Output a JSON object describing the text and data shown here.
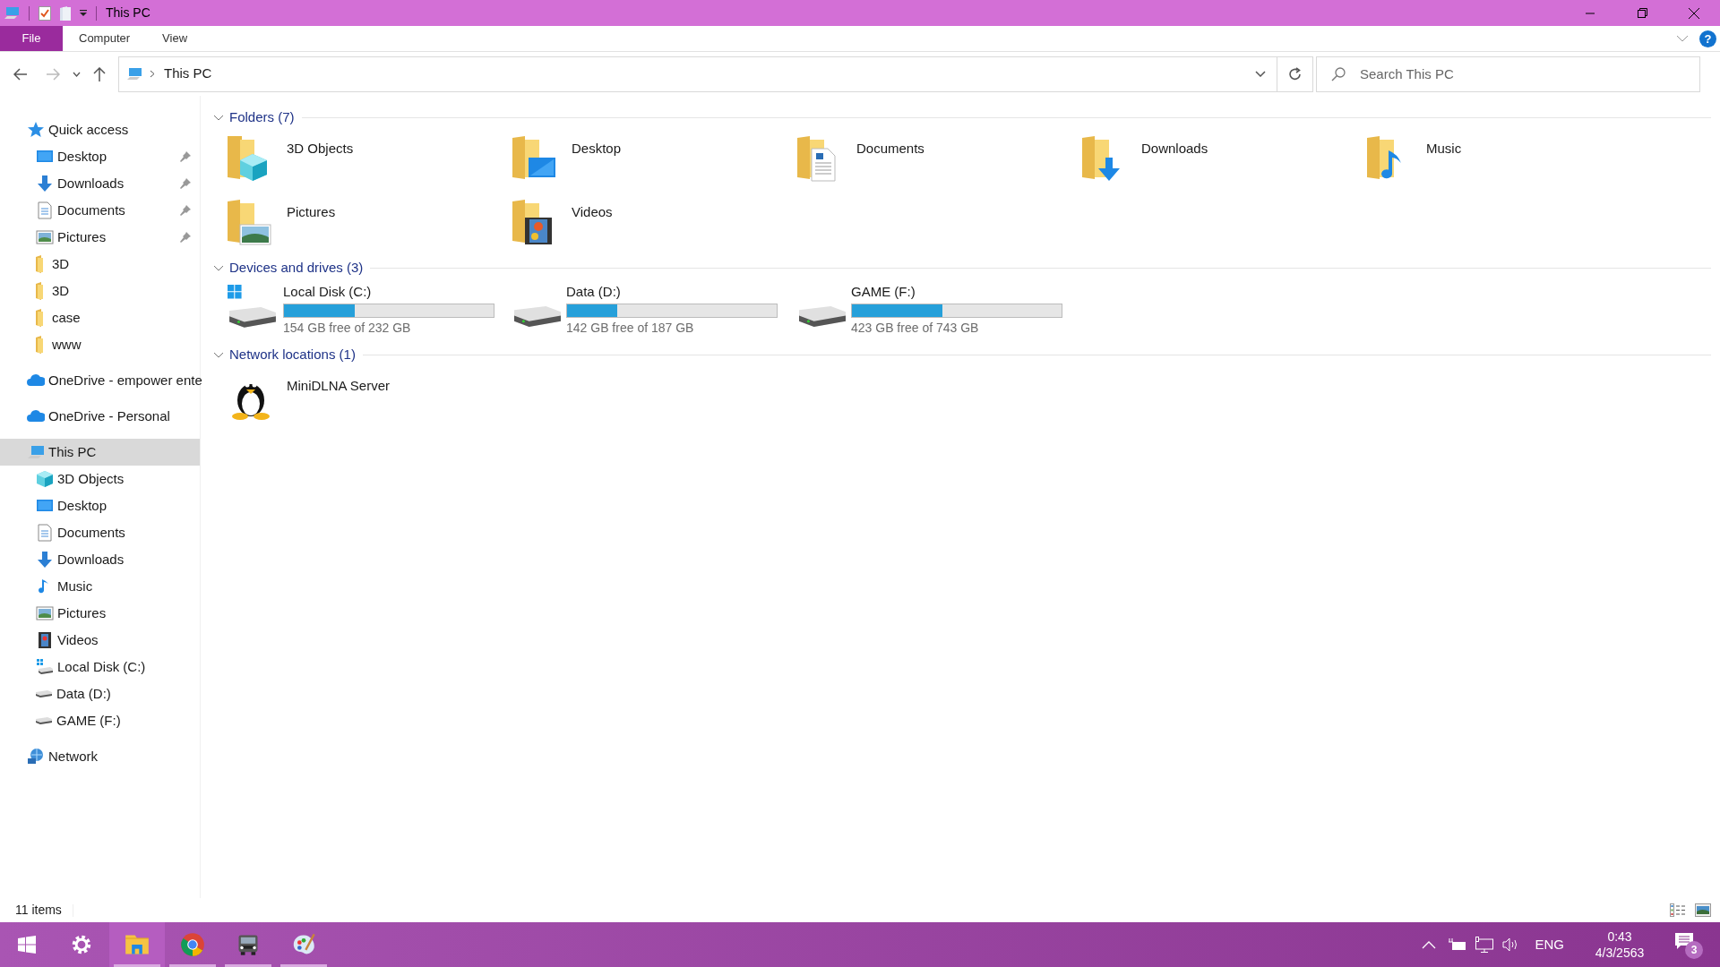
{
  "title_bar": {
    "title": "This PC"
  },
  "ribbon": {
    "help": "?",
    "tabs": [
      {
        "label": "File",
        "kind": "file"
      },
      {
        "label": "Computer",
        "kind": "tab"
      },
      {
        "label": "View",
        "kind": "tab"
      }
    ]
  },
  "address_bar": {
    "path": "This PC",
    "search_placeholder": "Search This PC"
  },
  "sidebar": {
    "items": [
      {
        "label": "Quick access",
        "kind": "star",
        "selected": false,
        "children": [
          {
            "label": "Desktop",
            "kind": "desktop",
            "pinned": true,
            "selected": false
          },
          {
            "label": "Downloads",
            "kind": "downloads",
            "pinned": true,
            "selected": false
          },
          {
            "label": "Documents",
            "kind": "documents",
            "pinned": true,
            "selected": false
          },
          {
            "label": "Pictures",
            "kind": "pictures",
            "pinned": true,
            "selected": false
          },
          {
            "label": "3D",
            "kind": "folder",
            "pinned": false,
            "selected": false
          },
          {
            "label": "3D",
            "kind": "folder",
            "pinned": false,
            "selected": false
          },
          {
            "label": "case",
            "kind": "folder",
            "pinned": false,
            "selected": false
          },
          {
            "label": "www",
            "kind": "folder",
            "pinned": false,
            "selected": false
          }
        ]
      },
      {
        "label": "OneDrive - empower ente",
        "kind": "cloud",
        "selected": false
      },
      {
        "label": "OneDrive - Personal",
        "kind": "cloud",
        "selected": false
      },
      {
        "label": "This PC",
        "kind": "pc",
        "selected": true,
        "children": [
          {
            "label": "3D Objects",
            "kind": "cube",
            "selected": false
          },
          {
            "label": "Desktop",
            "kind": "desktop",
            "selected": false
          },
          {
            "label": "Documents",
            "kind": "documents",
            "selected": false
          },
          {
            "label": "Downloads",
            "kind": "downloads",
            "selected": false
          },
          {
            "label": "Music",
            "kind": "music",
            "selected": false
          },
          {
            "label": "Pictures",
            "kind": "pictures",
            "selected": false
          },
          {
            "label": "Videos",
            "kind": "videos",
            "selected": false
          },
          {
            "label": "Local Disk (C:)",
            "kind": "windrive",
            "selected": false
          },
          {
            "label": "Data (D:)",
            "kind": "drive",
            "selected": false
          },
          {
            "label": "GAME (F:)",
            "kind": "drive",
            "selected": false
          }
        ]
      },
      {
        "label": "Network",
        "kind": "network",
        "selected": false
      }
    ]
  },
  "sections": [
    {
      "title": "Folders (7)",
      "kind": "folders",
      "expanded": true,
      "items": [
        {
          "name": "3D Objects",
          "kind": "cube"
        },
        {
          "name": "Desktop",
          "kind": "desktop"
        },
        {
          "name": "Documents",
          "kind": "documents"
        },
        {
          "name": "Downloads",
          "kind": "downloads"
        },
        {
          "name": "Music",
          "kind": "music"
        },
        {
          "name": "Pictures",
          "kind": "pictures"
        },
        {
          "name": "Videos",
          "kind": "videos"
        }
      ]
    },
    {
      "title": "Devices and drives (3)",
      "kind": "drives",
      "expanded": true,
      "items": [
        {
          "name": "Local Disk (C:)",
          "kind": "windrive",
          "level": 0.336,
          "free": "154 GB free of 232 GB"
        },
        {
          "name": "Data (D:)",
          "kind": "drive",
          "level": 0.241,
          "free": "142 GB free of 187 GB"
        },
        {
          "name": "GAME (F:)",
          "kind": "drive",
          "level": 0.431,
          "free": "423 GB free of 743 GB"
        }
      ]
    },
    {
      "title": "Network locations (1)",
      "kind": "network",
      "expanded": true,
      "items": [
        {
          "name": "MiniDLNA Server",
          "kind": "penguin"
        }
      ]
    }
  ],
  "status_bar": {
    "count": "11 items"
  },
  "taskbar": {
    "apps": [
      {
        "kind": "settings",
        "running": false,
        "active": false
      },
      {
        "kind": "explorer",
        "running": true,
        "active": true
      },
      {
        "kind": "chrome",
        "running": true,
        "active": false
      },
      {
        "kind": "truck",
        "running": true,
        "active": false
      },
      {
        "kind": "paint",
        "running": true,
        "active": false
      }
    ],
    "language": "ENG",
    "time": "0:43",
    "date": "4/3/2563",
    "notifications": "3"
  }
}
